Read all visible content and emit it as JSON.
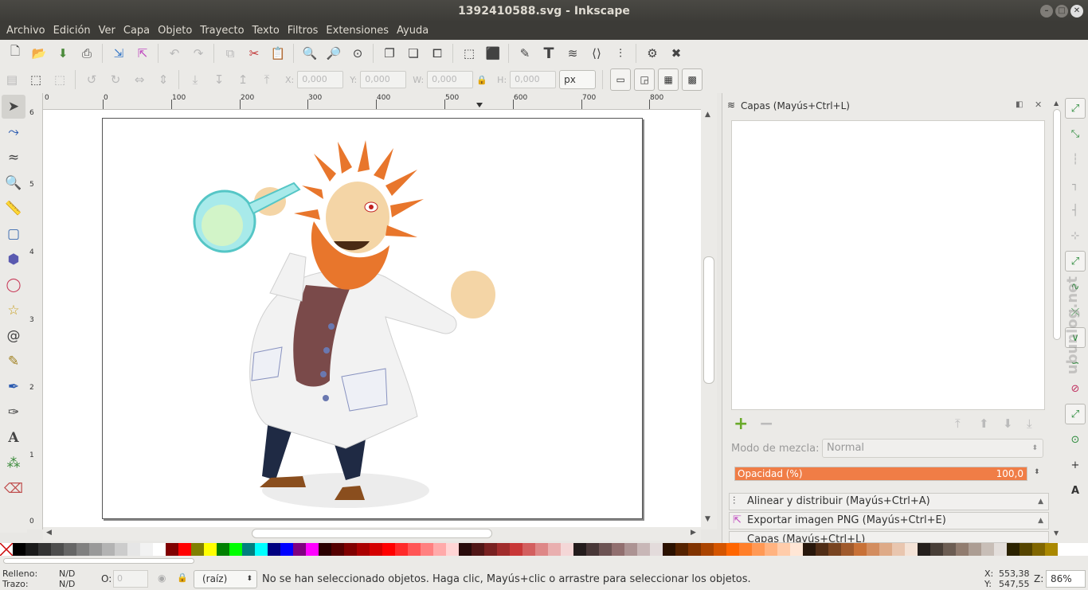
{
  "window": {
    "title": "1392410588.svg - Inkscape"
  },
  "menu": [
    "Archivo",
    "Edición",
    "Ver",
    "Capa",
    "Objeto",
    "Trayecto",
    "Texto",
    "Filtros",
    "Extensiones",
    "Ayuda"
  ],
  "controls": {
    "x_label": "X:",
    "x_value": "0,000",
    "y_label": "Y:",
    "y_value": "0,000",
    "w_label": "W:",
    "w_value": "0,000",
    "h_label": "H:",
    "h_value": "0,000",
    "unit": "px"
  },
  "ruler": {
    "labels": [
      "0",
      "100",
      "200",
      "300",
      "400",
      "500",
      "600",
      "700",
      "800"
    ],
    "vlabels": [
      "6",
      "5",
      "4",
      "3",
      "2",
      "1",
      "0"
    ]
  },
  "layers_panel": {
    "title": "Capas (Mayús+Ctrl+L)",
    "blend_label": "Modo de mezcla:",
    "blend_value": "Normal",
    "opacity_label": "Opacidad (%)",
    "opacity_value": "100,0",
    "opacity_fraction": 1.0
  },
  "docks": [
    "Alinear y distribuir (Mayús+Ctrl+A)",
    "Exportar imagen PNG (Mayús+Ctrl+E)",
    "Capas (Mayús+Ctrl+L)"
  ],
  "status": {
    "fill_label": "Relleno:",
    "fill_value": "N/D",
    "stroke_label": "Trazo:",
    "stroke_value": "N/D",
    "opacity_label": "O:",
    "opacity_value": "0",
    "layer": "(raíz)",
    "message": "No se han seleccionado objetos. Haga clic, Mayús+clic o arrastre para seleccionar los objetos.",
    "x_label": "X:",
    "x_value": "553,38",
    "y_label": "Y:",
    "y_value": "547,55",
    "zoom_label": "Z:",
    "zoom_value": "86%"
  },
  "palette": [
    "#000000",
    "#1a1a1a",
    "#333333",
    "#4d4d4d",
    "#666666",
    "#808080",
    "#999999",
    "#b3b3b3",
    "#cccccc",
    "#e6e6e6",
    "#f2f2f2",
    "#ffffff",
    "#800000",
    "#ff0000",
    "#808000",
    "#ffff00",
    "#008000",
    "#00ff00",
    "#008080",
    "#00ffff",
    "#000080",
    "#0000ff",
    "#800080",
    "#ff00ff",
    "#2b0000",
    "#550000",
    "#800000",
    "#aa0000",
    "#d40000",
    "#ff0000",
    "#ff2a2a",
    "#ff5555",
    "#ff8080",
    "#ffaaaa",
    "#ffd5d5",
    "#280b0b",
    "#501616",
    "#782121",
    "#a02c2c",
    "#c83737",
    "#d35f5f",
    "#de8787",
    "#e9afaf",
    "#f4d7d7",
    "#241c1c",
    "#483737",
    "#6c5353",
    "#916f6f",
    "#ac9393",
    "#c8b7b7",
    "#e3dbdb",
    "#2b1100",
    "#552200",
    "#803300",
    "#aa4400",
    "#d45500",
    "#ff6600",
    "#ff7f2a",
    "#ff9955",
    "#ffb380",
    "#ffccaa",
    "#ffe6d5",
    "#28170b",
    "#502d16",
    "#784421",
    "#a05a2c",
    "#c87137",
    "#d38d5f",
    "#deaa87",
    "#e9c6af",
    "#f4e3d7",
    "#241f1c",
    "#483e37",
    "#6c5d53",
    "#917c6f",
    "#ac9d93",
    "#c8beb7",
    "#e3dedb",
    "#2b2200",
    "#554400",
    "#806600",
    "#aa8800"
  ],
  "watermark": "ubunlog.net",
  "icons": {
    "select": "arrow-icon",
    "node": "node-icon",
    "tweak": "tweak-icon",
    "zoom": "zoom-icon",
    "measure": "measure-icon",
    "rect": "rect-icon",
    "box3d": "box3d-icon",
    "circle": "circle-icon",
    "star": "star-icon",
    "spiral": "spiral-icon",
    "pencil": "pencil-icon",
    "pen": "pen-icon",
    "calligraphy": "calligraphy-icon",
    "text": "text-icon",
    "spray": "spray-icon",
    "eraser": "eraser-icon"
  }
}
